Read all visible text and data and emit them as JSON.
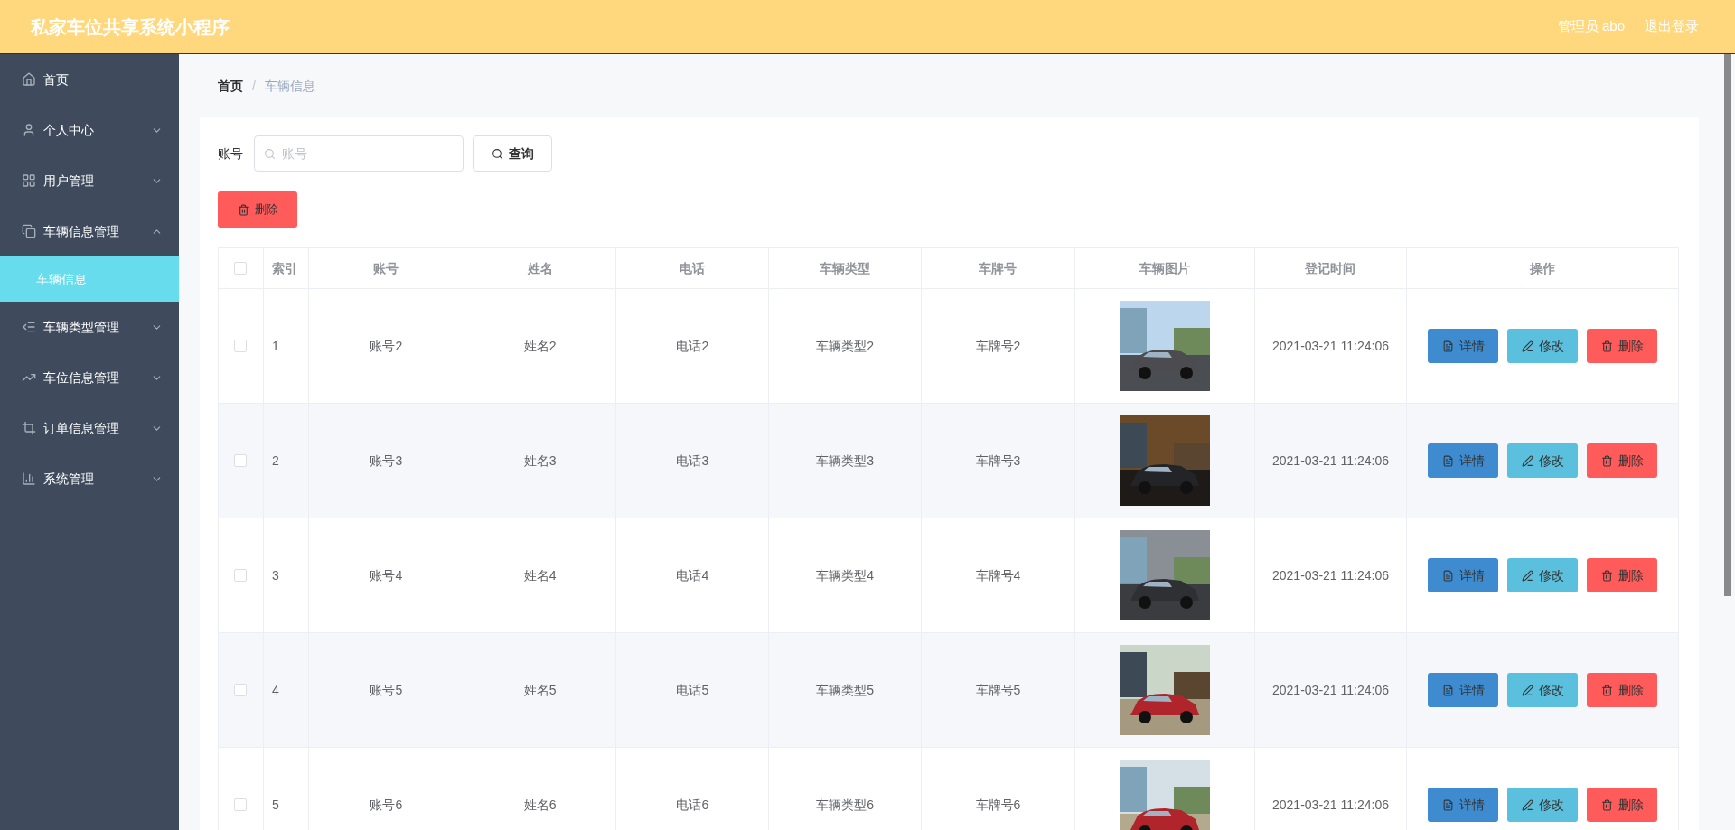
{
  "header": {
    "title": "私家车位共享系统小程序",
    "user": "管理员 abo",
    "logout": "退出登录"
  },
  "sidebar": {
    "items": [
      {
        "label": "首页"
      },
      {
        "label": "个人中心",
        "expanded": false
      },
      {
        "label": "用户管理",
        "expanded": false
      },
      {
        "label": "车辆信息管理",
        "expanded": true,
        "children": [
          {
            "label": "车辆信息",
            "selected": true
          }
        ]
      },
      {
        "label": "车辆类型管理",
        "expanded": false
      },
      {
        "label": "车位信息管理",
        "expanded": false
      },
      {
        "label": "订单信息管理",
        "expanded": false
      },
      {
        "label": "系统管理",
        "expanded": false
      }
    ]
  },
  "breadcrumb": [
    "首页",
    "/",
    "车辆信息"
  ],
  "search": {
    "label": "账号",
    "placeholder": "账号",
    "button": "查询"
  },
  "delete_button": "删除",
  "table": {
    "header_checked": false,
    "columns": [
      "索引",
      "账号",
      "姓名",
      "电话",
      "车辆类型",
      "车牌号",
      "车辆图片",
      "登记时间",
      "操作"
    ],
    "rows": [
      {
        "checked": false,
        "cells": [
          "1",
          "账号2",
          "姓名2",
          "电话2",
          "车辆类型2",
          "车牌号2"
        ],
        "time": "2021-03-21 11:24:06",
        "actions": [
          "详情",
          "修改",
          "删除"
        ]
      },
      {
        "checked": false,
        "cells": [
          "2",
          "账号3",
          "姓名3",
          "电话3",
          "车辆类型3",
          "车牌号3"
        ],
        "time": "2021-03-21 11:24:06",
        "actions": [
          "详情",
          "修改",
          "删除"
        ]
      },
      {
        "checked": false,
        "cells": [
          "3",
          "账号4",
          "姓名4",
          "电话4",
          "车辆类型4",
          "车牌号4"
        ],
        "time": "2021-03-21 11:24:06",
        "actions": [
          "详情",
          "修改",
          "删除"
        ]
      },
      {
        "checked": false,
        "cells": [
          "4",
          "账号5",
          "姓名5",
          "电话5",
          "车辆类型5",
          "车牌号5"
        ],
        "time": "2021-03-21 11:24:06",
        "actions": [
          "详情",
          "修改",
          "删除"
        ]
      },
      {
        "checked": false,
        "cells": [
          "5",
          "账号6",
          "姓名6",
          "电话6",
          "车辆类型6",
          "车牌号6"
        ],
        "time": "2021-03-21 11:24:06",
        "actions": [
          "详情",
          "修改",
          "删除"
        ]
      }
    ]
  }
}
